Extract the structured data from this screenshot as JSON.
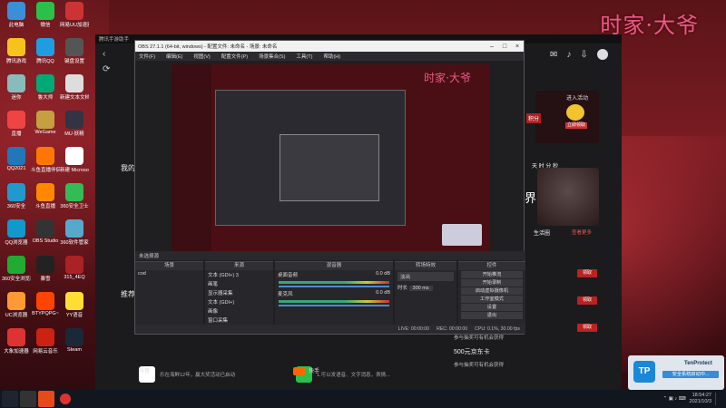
{
  "watermark": "时家·大爷",
  "desktop_icons": [
    {
      "label": "此电脑",
      "color": "#3a8fd8"
    },
    {
      "label": "微信",
      "color": "#2ac04a"
    },
    {
      "label": "网易UU加速器",
      "color": "#c33"
    },
    {
      "label": "腾讯游戏",
      "color": "#f5c31c"
    },
    {
      "label": "腾讯QQ",
      "color": "#1e9ee0"
    },
    {
      "label": "键盘设置",
      "color": "#555"
    },
    {
      "label": "迷你",
      "color": "#8bb"
    },
    {
      "label": "鲁大师",
      "color": "#0a7"
    },
    {
      "label": "新建文本文档",
      "color": "#ddd"
    },
    {
      "label": "直播",
      "color": "#e44"
    },
    {
      "label": "WeGame",
      "color": "#c4a040"
    },
    {
      "label": "MU·妖精",
      "color": "#334"
    },
    {
      "label": "QQ2021",
      "color": "#27b"
    },
    {
      "label": "斗鱼直播伴侣",
      "color": "#f70"
    },
    {
      "label": "新建 Microsoft",
      "color": "#fff"
    },
    {
      "label": "360安全",
      "color": "#29c"
    },
    {
      "label": "斗鱼直播",
      "color": "#f80"
    },
    {
      "label": "360安全卫士",
      "color": "#3b5"
    },
    {
      "label": "QQ浏览器",
      "color": "#19c"
    },
    {
      "label": "OBS Studio",
      "color": "#333"
    },
    {
      "label": "360软件管家",
      "color": "#5ac"
    },
    {
      "label": "360安全浏览器",
      "color": "#2a3"
    },
    {
      "label": "暴雪",
      "color": "#222"
    },
    {
      "label": "315_4EQ",
      "color": "#a22"
    },
    {
      "label": "UC浏览器",
      "color": "#f93"
    },
    {
      "label": "BTYPQPG~",
      "color": "#f40"
    },
    {
      "label": "YY语音",
      "color": "#fd3"
    },
    {
      "label": "大象加速器",
      "color": "#d33"
    },
    {
      "label": "网易云音乐",
      "color": "#c21"
    },
    {
      "label": "Steam",
      "color": "#1b2838"
    }
  ],
  "host": {
    "title": "腾讯手游助手",
    "labels": {
      "mine": "我的",
      "recommend": "推荐"
    },
    "apps": [
      {
        "label": "乐在海鲜12年，赢大奖活动已启动",
        "icon": "app-a"
      },
      {
        "label": "1.可以发语音、文字消息，表情...",
        "icon": "wechat"
      },
      {
        "label": "抖音",
        "icon": "douyin"
      },
      {
        "label": "快手",
        "icon": "kuaishou"
      }
    ],
    "right": {
      "activity_btn": "进入活动",
      "sign_btn": "立即领取",
      "points_label": "积分",
      "countdown": "天 时 分 秒",
      "world": "界",
      "live": "生活圈",
      "more": "查看更多",
      "get": "领取",
      "jd_card": "500元京东卡",
      "jd_sub": "参与抽奖可有机会获得",
      "jd_sub2": "参与抽奖可有机会获得"
    }
  },
  "obs": {
    "title": "OBS 27.1.1 (64-bit, windows) - 配置文件: 未命名 - 场景: 未命名",
    "menu": [
      "文件(F)",
      "编辑(E)",
      "视图(V)",
      "配置文件(P)",
      "场景集合(S)",
      "工具(T)",
      "帮助(H)"
    ],
    "watermark_inner": "时家·大爷",
    "status_strip": "未选择源",
    "docks": {
      "scenes": "场景",
      "sources": "来源",
      "mixer": "混音器",
      "transitions": "转场特效",
      "controls": "控件"
    },
    "scene_items": [
      "cod"
    ],
    "source_items": [
      "文本 (GDI+) 3",
      "画笔",
      "显示器采集",
      "文本 (GDI+)",
      "画像",
      "窗口采集"
    ],
    "mixer_items": [
      {
        "name": "桌面音频",
        "db": "0.0 dB"
      },
      {
        "name": "麦克风",
        "db": "0.0 dB"
      }
    ],
    "transition": {
      "type": "淡出",
      "duration_label": "时长",
      "duration": "300 ms"
    },
    "controls": [
      "开始推流",
      "开始录制",
      "启动虚拟摄像机",
      "工作室模式",
      "设置",
      "退出"
    ],
    "statusbar": [
      "LIVE: 00:00:00",
      "REC: 00:00:00",
      "CPU: 0.1%, 30.00 fps"
    ]
  },
  "toast": {
    "title": "TenProtect",
    "status": "安全系统启动中..."
  },
  "taskbar": {
    "time": "18:54:27",
    "date": "2021/10/3"
  }
}
